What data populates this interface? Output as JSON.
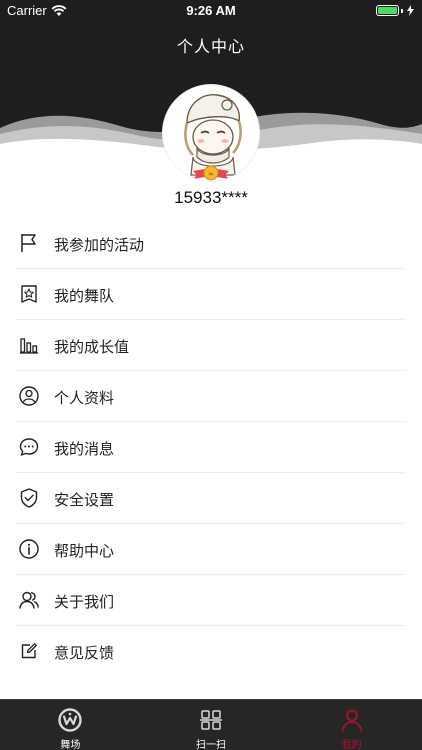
{
  "status_bar": {
    "carrier": "Carrier",
    "time": "9:26 AM"
  },
  "header": {
    "title": "个人中心"
  },
  "profile": {
    "username": "15933****"
  },
  "menu": {
    "items": [
      {
        "label": "我参加的活动",
        "icon": "flag-icon"
      },
      {
        "label": "我的舞队",
        "icon": "star-badge-icon"
      },
      {
        "label": "我的成长值",
        "icon": "bar-chart-icon"
      },
      {
        "label": "个人资料",
        "icon": "user-circle-icon"
      },
      {
        "label": "我的消息",
        "icon": "chat-bubble-icon"
      },
      {
        "label": "安全设置",
        "icon": "shield-check-icon"
      },
      {
        "label": "帮助中心",
        "icon": "info-icon"
      },
      {
        "label": "关于我们",
        "icon": "users-icon"
      },
      {
        "label": "意见反馈",
        "icon": "edit-icon"
      }
    ]
  },
  "tabbar": {
    "tabs": [
      {
        "label": "舞场",
        "icon": "dance-logo-icon",
        "active": false
      },
      {
        "label": "扫一扫",
        "icon": "scan-icon",
        "active": false
      },
      {
        "label": "我的",
        "icon": "person-icon",
        "active": true
      }
    ]
  },
  "colors": {
    "header_bg": "#1e1e1e",
    "accent": "#b0102a",
    "battery": "#4cd964",
    "tabbar_bg": "#262626"
  }
}
